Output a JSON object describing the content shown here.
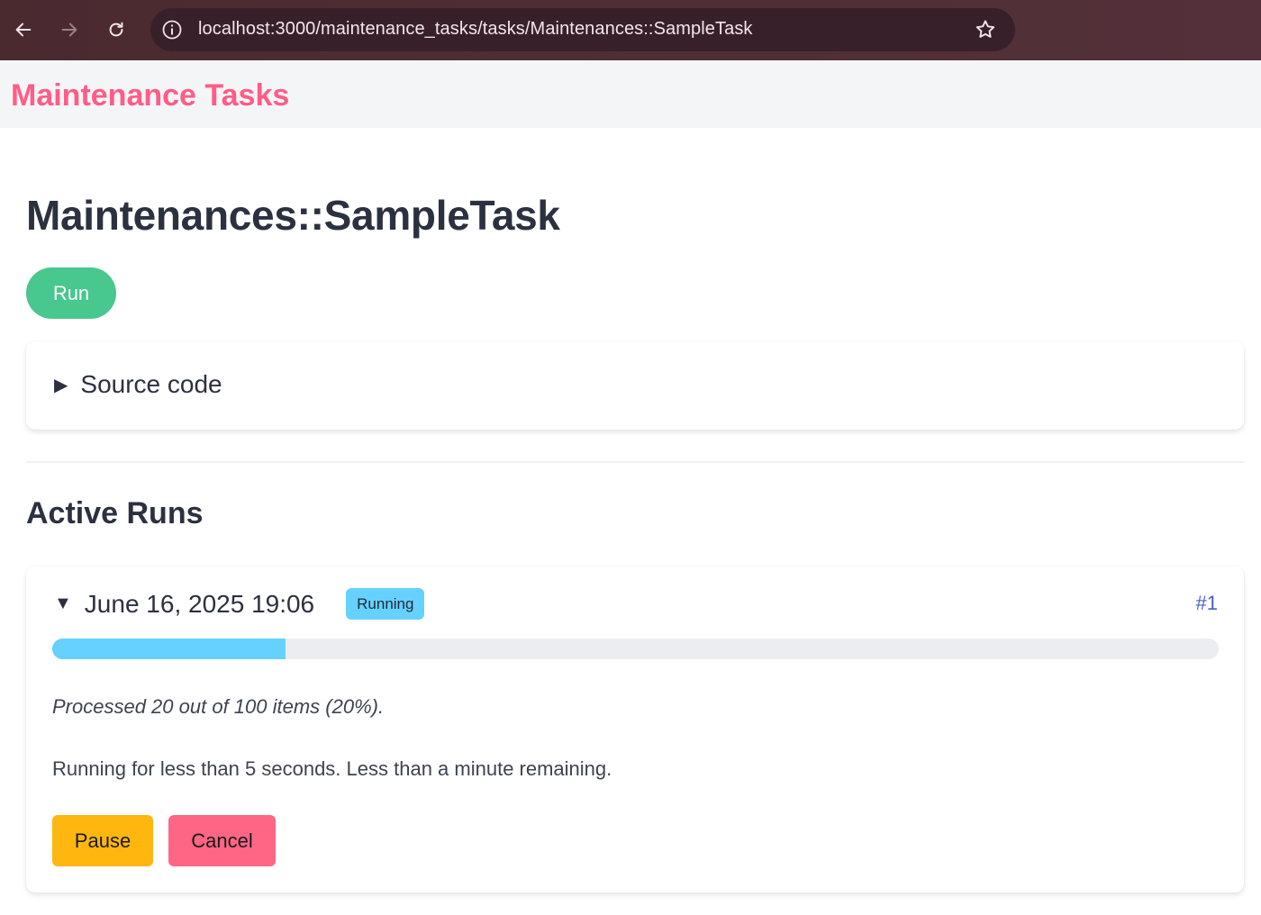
{
  "browser": {
    "url": "localhost:3000/maintenance_tasks/tasks/Maintenances::SampleTask"
  },
  "app": {
    "brand": "Maintenance Tasks"
  },
  "task": {
    "title": "Maintenances::SampleTask",
    "run_label": "Run",
    "source_code_label": "Source code"
  },
  "active_runs": {
    "heading": "Active Runs",
    "runs": [
      {
        "date": "June 16, 2025 19:06",
        "status": "Running",
        "id_label": "#1",
        "progress_fraction": 0.2,
        "processed_text": "Processed 20 out of 100 items (20%).",
        "runtime_text": "Running for less than 5 seconds. Less than a minute remaining.",
        "pause_label": "Pause",
        "cancel_label": "Cancel"
      }
    ]
  },
  "colors": {
    "brand": "#ff5d86",
    "run_button": "#48c78e",
    "running_tag": "#66d1ff",
    "pause_button": "#ffb70f",
    "cancel_button": "#ff6685",
    "link": "#485fc7"
  },
  "icons": {
    "back": "arrow-left-icon",
    "forward": "arrow-right-icon",
    "reload": "reload-icon",
    "site_info": "info-icon",
    "bookmark": "star-icon",
    "collapsed": "triangle-right-icon",
    "expanded": "triangle-down-icon"
  }
}
